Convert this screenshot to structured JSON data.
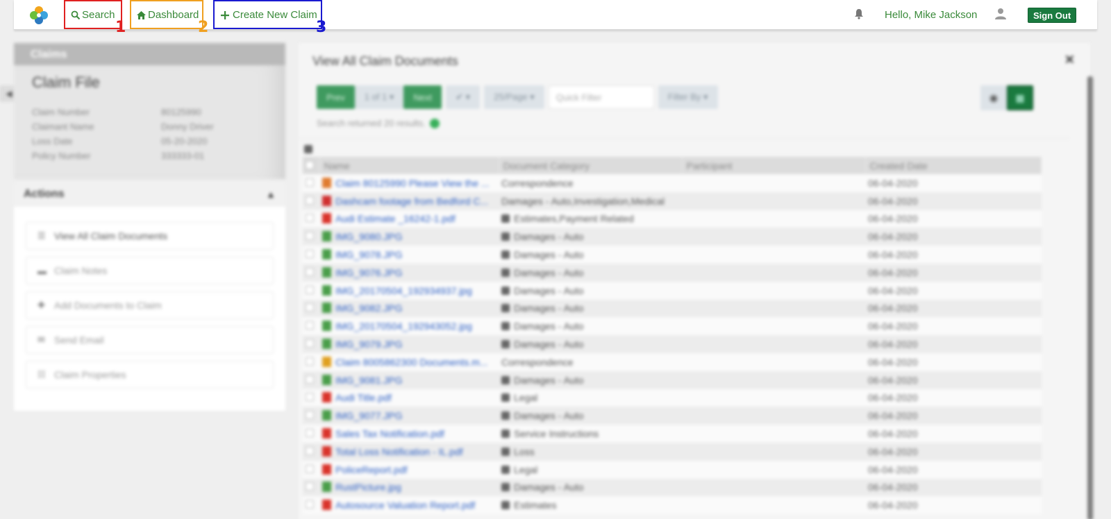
{
  "nav": {
    "search": "Search",
    "dashboard": "Dashboard",
    "create": "Create New Claim",
    "greeting": "Hello, Mike Jackson",
    "signout": "Sign Out",
    "markers": [
      "1",
      "2",
      "3"
    ]
  },
  "left": {
    "header": "Claims",
    "title": "Claim File",
    "fields": [
      {
        "k": "Claim Number",
        "v": "80125990"
      },
      {
        "k": "Claimant Name",
        "v": "Donny Driver"
      },
      {
        "k": "Loss Date",
        "v": "05-20-2020"
      },
      {
        "k": "Policy Number",
        "v": "333333-01"
      }
    ],
    "actions_title": "Actions",
    "actions": [
      "View All Claim Documents",
      "Claim Notes",
      "Add Documents to Claim",
      "Send Email",
      "Claim Properties"
    ]
  },
  "main": {
    "title": "View All Claim Documents",
    "prev": "Prev",
    "pages": "1 of 1 ▾",
    "next": "Next",
    "check": "✔ ▾",
    "per_page": "25/Page ▾",
    "quick_filter": "Quick Filter",
    "filter_by": "Filter By ▾",
    "results": "Search returned 20 results.",
    "columns": [
      "Name",
      "Document Category",
      "Participant",
      "Created Date"
    ],
    "rows": [
      {
        "name": "Claim 80125990 Please View the ...",
        "type": "msg",
        "cat": "Correspondence",
        "icon": false,
        "date": "06-04-2020"
      },
      {
        "name": "Dashcam footage from Bedford C...",
        "type": "vid",
        "cat": "Damages - Auto,Investigation,Medical",
        "icon": false,
        "date": "06-04-2020"
      },
      {
        "name": "Audi Estimate _16242-1.pdf",
        "type": "pdf",
        "cat": "Estimates,Payment Related",
        "icon": true,
        "date": "06-04-2020"
      },
      {
        "name": "IMG_9080.JPG",
        "type": "img",
        "cat": "Damages - Auto",
        "icon": true,
        "date": "06-04-2020"
      },
      {
        "name": "IMG_9078.JPG",
        "type": "img",
        "cat": "Damages - Auto",
        "icon": true,
        "date": "06-04-2020"
      },
      {
        "name": "IMG_9076.JPG",
        "type": "img",
        "cat": "Damages - Auto",
        "icon": true,
        "date": "06-04-2020"
      },
      {
        "name": "IMG_20170504_192934937.jpg",
        "type": "img",
        "cat": "Damages - Auto",
        "icon": true,
        "date": "06-04-2020"
      },
      {
        "name": "IMG_9082.JPG",
        "type": "img",
        "cat": "Damages - Auto",
        "icon": true,
        "date": "06-04-2020"
      },
      {
        "name": "IMG_20170504_192943052.jpg",
        "type": "img",
        "cat": "Damages - Auto",
        "icon": true,
        "date": "06-04-2020"
      },
      {
        "name": "IMG_9079.JPG",
        "type": "img",
        "cat": "Damages - Auto",
        "icon": true,
        "date": "06-04-2020"
      },
      {
        "name": "Claim 8005862300 Documents.m...",
        "type": "mail",
        "cat": "Correspondence",
        "icon": false,
        "date": "06-04-2020"
      },
      {
        "name": "IMG_9081.JPG",
        "type": "img",
        "cat": "Damages - Auto",
        "icon": true,
        "date": "06-04-2020"
      },
      {
        "name": "Audi Title.pdf",
        "type": "pdf",
        "cat": "Legal",
        "icon": true,
        "date": "06-04-2020"
      },
      {
        "name": "IMG_9077.JPG",
        "type": "img",
        "cat": "Damages - Auto",
        "icon": true,
        "date": "06-04-2020"
      },
      {
        "name": "Sales Tax Notification.pdf",
        "type": "pdf",
        "cat": "Service Instructions",
        "icon": true,
        "date": "06-04-2020"
      },
      {
        "name": "Total Loss Notification - IL.pdf",
        "type": "pdf",
        "cat": "Loss",
        "icon": true,
        "date": "06-04-2020"
      },
      {
        "name": "PoliceReport.pdf",
        "type": "pdf",
        "cat": "Legal",
        "icon": true,
        "date": "06-04-2020"
      },
      {
        "name": "RustPicture.jpg",
        "type": "img",
        "cat": "Damages - Auto",
        "icon": true,
        "date": "06-04-2020"
      },
      {
        "name": "Autosource Valuation Report.pdf",
        "type": "pdf",
        "cat": "Estimates",
        "icon": true,
        "date": "06-04-2020"
      }
    ]
  },
  "colors": {
    "accent": "#3a8a3a",
    "signout": "#1a7a3f",
    "red": "#e02020",
    "orange": "#f0a020",
    "blue": "#1a1ad0"
  }
}
